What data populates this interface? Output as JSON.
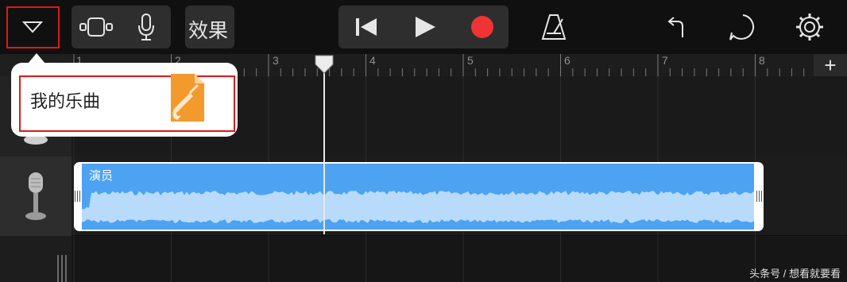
{
  "toolbar": {
    "effects_label": "效果"
  },
  "ruler": {
    "bars": [
      "1",
      "2",
      "3",
      "4",
      "5",
      "6",
      "7",
      "8"
    ],
    "add_label": "+"
  },
  "popover": {
    "song_title": "我的乐曲"
  },
  "tracks": [
    {
      "region_title": "演员"
    }
  ],
  "watermark": "头条号 / 想看就要看",
  "colors": {
    "record": "#f03434",
    "region": "#4da2f2",
    "highlight": "#e01818"
  }
}
